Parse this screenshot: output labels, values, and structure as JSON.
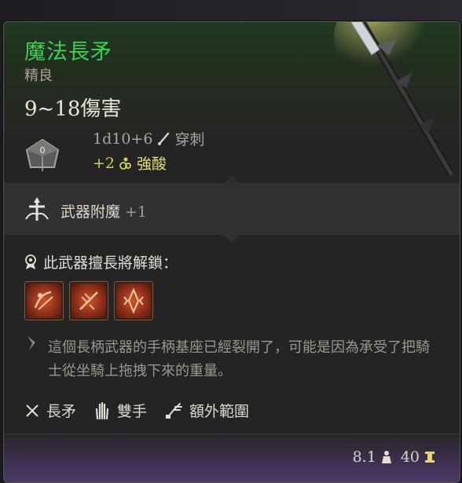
{
  "item": {
    "name": "魔法長矛",
    "rarity": "精良",
    "damage": "9~18傷害",
    "dice_roll": "1d10+6",
    "damage_type": "穿刺",
    "bonus_amount": "+2",
    "bonus_type": "強酸",
    "die_label": "0"
  },
  "enchantment": {
    "label": "武器附魔",
    "value": "+1"
  },
  "unlock": {
    "heading": "此武器擅長將解鎖：",
    "actions": [
      "action-1",
      "action-2",
      "action-3"
    ]
  },
  "description": "這個長柄武器的手柄基座已經裂開了，可能是因為承受了把騎士從坐騎上拖拽下來的重量。",
  "tags": [
    {
      "label": "長矛",
      "icon": "spear-tag-icon"
    },
    {
      "label": "雙手",
      "icon": "two-hands-icon"
    },
    {
      "label": "額外範圍",
      "icon": "reach-icon"
    }
  ],
  "footer": {
    "weight": "8.1",
    "price": "40"
  },
  "colors": {
    "title": "#3fcf55",
    "bonus": "#d6d05a",
    "footer_purple": "#4d3a68"
  }
}
